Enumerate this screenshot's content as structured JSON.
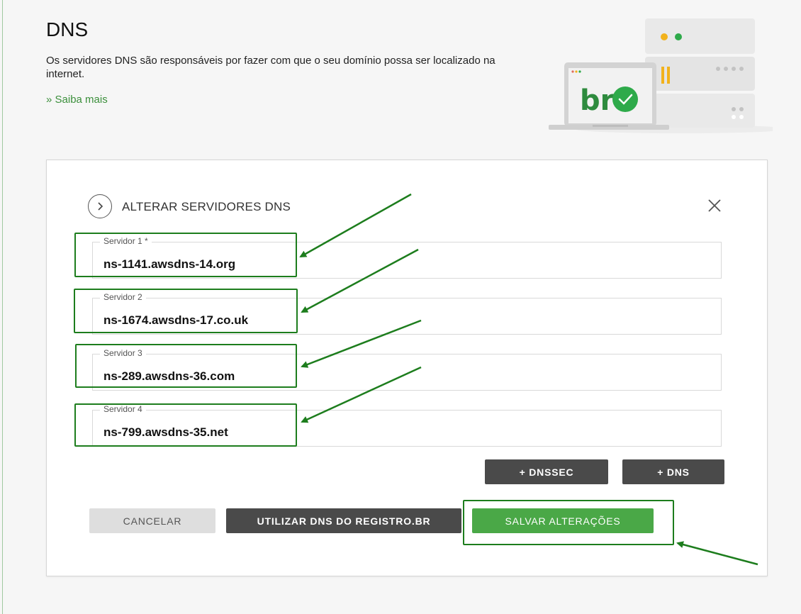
{
  "page": {
    "title": "DNS",
    "description": "Os servidores DNS são responsáveis por fazer com que o seu domínio possa ser localizado na internet.",
    "learn_more": "» Saiba mais"
  },
  "illustration": {
    "laptop_text": "br"
  },
  "panel": {
    "title": "ALTERAR SERVIDORES DNS",
    "fields": [
      {
        "label": "Servidor 1 *",
        "value": "ns-1141.awsdns-14.org"
      },
      {
        "label": "Servidor 2",
        "value": "ns-1674.awsdns-17.co.uk"
      },
      {
        "label": "Servidor 3",
        "value": "ns-289.awsdns-36.com"
      },
      {
        "label": "Servidor 4",
        "value": "ns-799.awsdns-35.net"
      }
    ],
    "add_dnssec": "+ DNSSEC",
    "add_dns": "+ DNS",
    "cancel": "CANCELAR",
    "use_registro_dns": "UTILIZAR DNS DO REGISTRO.BR",
    "save": "SALVAR ALTERAÇÕES"
  },
  "colors": {
    "accent_green": "#4aa847",
    "annotation_green": "#1d7d1d",
    "dark_button": "#4a4a4a",
    "light_button": "#dedede"
  }
}
